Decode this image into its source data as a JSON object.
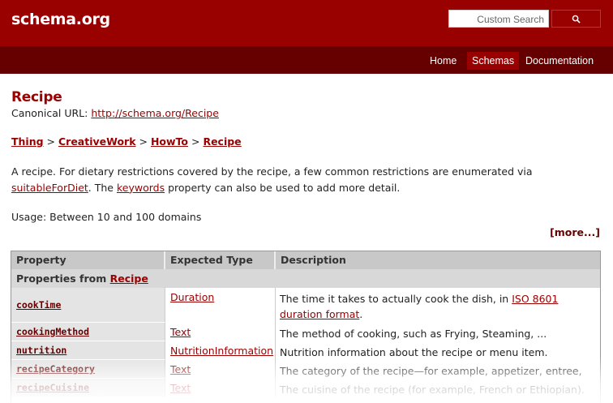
{
  "header": {
    "logo": "schema.org",
    "search_placeholder": "Custom Search"
  },
  "nav": {
    "items": [
      {
        "label": "Home",
        "active": false
      },
      {
        "label": "Schemas",
        "active": true
      },
      {
        "label": "Documentation",
        "active": false
      }
    ]
  },
  "page": {
    "title": "Recipe",
    "canonical_label": "Canonical URL: ",
    "canonical_url": "http://schema.org/Recipe",
    "breadcrumb": [
      "Thing",
      "CreativeWork",
      "HowTo",
      "Recipe"
    ],
    "breadcrumb_sep": " > ",
    "desc_part1": "A recipe. For dietary restrictions covered by the recipe, a few common restrictions are enumerated via ",
    "desc_link1": "suitableForDiet",
    "desc_part2": ". The ",
    "desc_link2": "keywords",
    "desc_part3": " property can also be used to add more detail.",
    "usage": "Usage: Between 10 and 100 domains",
    "more": "[more...]"
  },
  "table": {
    "headers": [
      "Property",
      "Expected Type",
      "Description"
    ],
    "group_prefix": "Properties from ",
    "group_link": "Recipe",
    "rows": [
      {
        "property": "cookTime",
        "type": "Duration",
        "desc_a": "The time it takes to actually cook the dish, in ",
        "desc_link": "ISO 8601 duration format",
        "desc_b": "."
      },
      {
        "property": "cookingMethod",
        "type": "Text",
        "desc_a": "The method of cooking, such as Frying, Steaming, ...",
        "desc_link": "",
        "desc_b": ""
      },
      {
        "property": "nutrition",
        "type": "NutritionInformation",
        "desc_a": "Nutrition information about the recipe or menu item.",
        "desc_link": "",
        "desc_b": ""
      },
      {
        "property": "recipeCategory",
        "type": "Text",
        "desc_a": "The category of the recipe—for example, appetizer, entree, etc.",
        "desc_link": "",
        "desc_b": ""
      },
      {
        "property": "recipeCuisine",
        "type": "Text",
        "desc_a": "The cuisine of the recipe (for example, French or Ethiopian).",
        "desc_link": "",
        "desc_b": ""
      }
    ]
  },
  "colors": {
    "brand_red": "#990000",
    "nav_dark": "#660000"
  }
}
